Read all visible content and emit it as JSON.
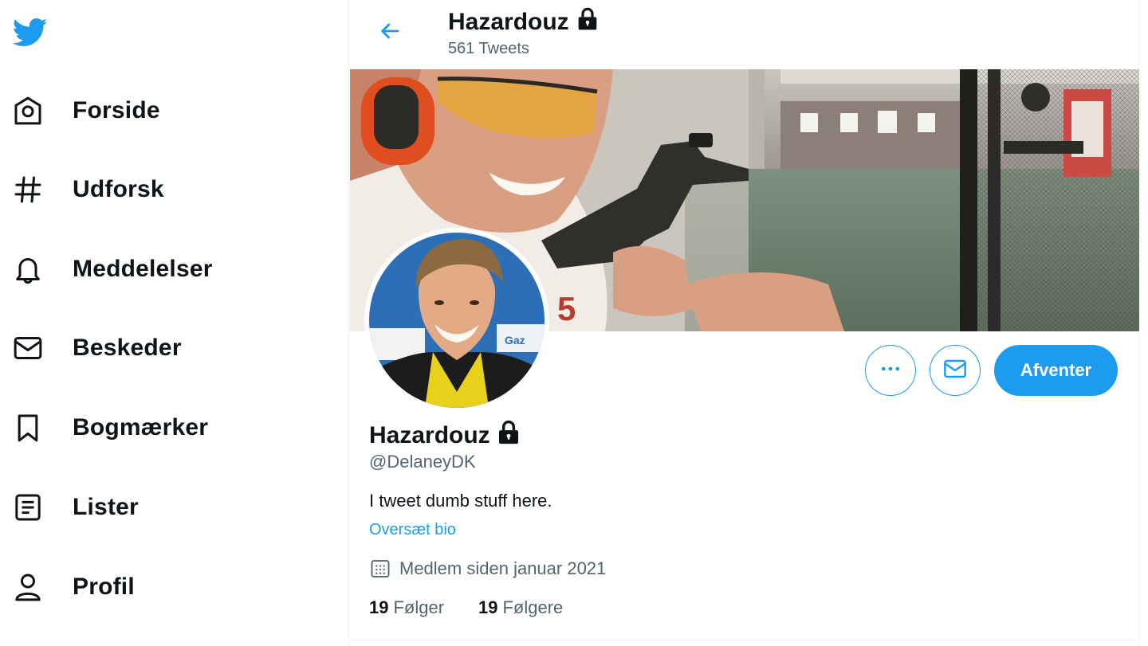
{
  "sidebar": {
    "logo_icon": "twitter-bird-icon",
    "items": [
      {
        "label": "Forside",
        "icon": "home-icon"
      },
      {
        "label": "Udforsk",
        "icon": "hashtag-icon"
      },
      {
        "label": "Meddelelser",
        "icon": "bell-icon"
      },
      {
        "label": "Beskeder",
        "icon": "envelope-icon"
      },
      {
        "label": "Bogmærker",
        "icon": "bookmark-icon"
      },
      {
        "label": "Lister",
        "icon": "list-icon"
      },
      {
        "label": "Profil",
        "icon": "person-icon"
      }
    ]
  },
  "header": {
    "back_icon": "arrow-left-icon",
    "name": "Hazardouz",
    "tweet_count": "561 Tweets",
    "protected_icon": "lock-icon"
  },
  "profile": {
    "name": "Hazardouz",
    "handle": "@DelaneyDK",
    "bio": "I tweet dumb stuff here.",
    "translate_label": "Oversæt bio",
    "joined": "Medlem siden januar 2021",
    "following_count": "19",
    "following_label": "Følger",
    "followers_count": "19",
    "followers_label": "Følgere"
  },
  "actions": {
    "more_icon": "more-dots-icon",
    "message_icon": "envelope-icon",
    "pending_label": "Afventer"
  },
  "colors": {
    "accent": "#1d9bf0",
    "text": "#0f1419",
    "muted": "#536471"
  }
}
